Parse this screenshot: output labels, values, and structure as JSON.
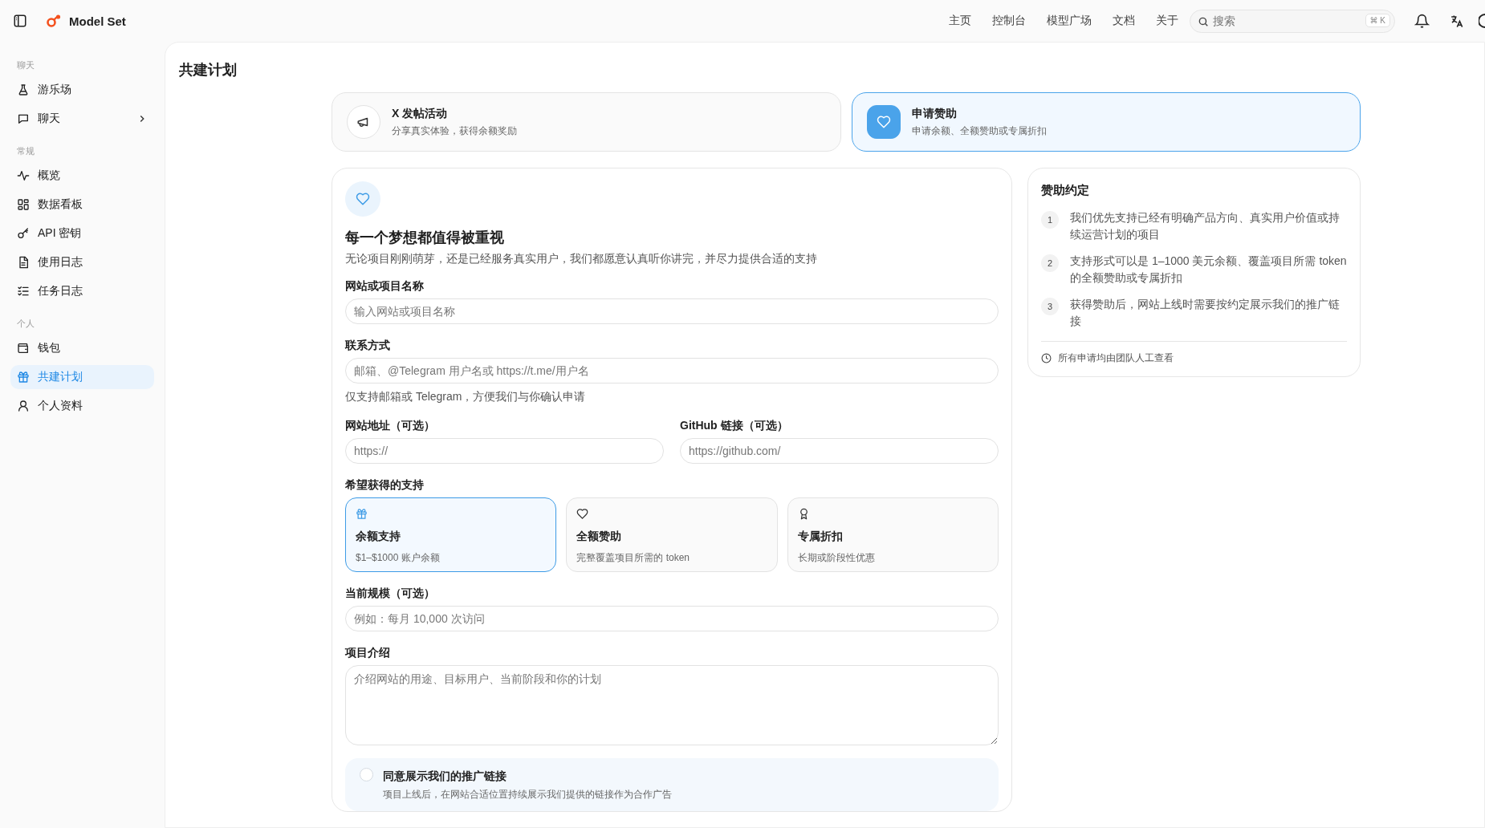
{
  "header": {
    "brand": "Model Set",
    "nav": [
      {
        "label": "主页"
      },
      {
        "label": "控制台"
      },
      {
        "label": "模型广场"
      },
      {
        "label": "文档"
      },
      {
        "label": "关于"
      }
    ],
    "search": {
      "placeholder": "搜索",
      "shortcut": "⌘ K"
    }
  },
  "sidebar": {
    "sections": [
      {
        "title": "聊天",
        "items": [
          {
            "label": "游乐场",
            "kind": "flask",
            "selected": false
          },
          {
            "label": "聊天",
            "kind": "chat",
            "selected": false,
            "expandable": true
          }
        ]
      },
      {
        "title": "常规",
        "items": [
          {
            "label": "概览",
            "kind": "pulse",
            "selected": false
          },
          {
            "label": "数据看板",
            "kind": "grid",
            "selected": false
          },
          {
            "label": "API 密钥",
            "kind": "key",
            "selected": false
          },
          {
            "label": "使用日志",
            "kind": "file",
            "selected": false
          },
          {
            "label": "任务日志",
            "kind": "list",
            "selected": false
          }
        ]
      },
      {
        "title": "个人",
        "items": [
          {
            "label": "钱包",
            "kind": "wallet",
            "selected": false
          },
          {
            "label": "共建计划",
            "kind": "gift",
            "selected": true
          },
          {
            "label": "个人资料",
            "kind": "user",
            "selected": false
          }
        ]
      }
    ]
  },
  "page": {
    "title": "共建计划"
  },
  "program_tabs": [
    {
      "title": "X 发帖活动",
      "subtitle": "分享真实体验，获得余额奖励",
      "kind": "megaphone",
      "selected": false
    },
    {
      "title": "申请赞助",
      "subtitle": "申请余额、全额赞助或专属折扣",
      "kind": "heart",
      "selected": true
    }
  ],
  "form": {
    "heading": "每一个梦想都值得被重视",
    "description": "无论项目刚刚萌芽，还是已经服务真实用户，我们都愿意认真听你讲完，并尽力提供合适的支持",
    "name_field": {
      "label": "网站或项目名称",
      "placeholder": "输入网站或项目名称"
    },
    "contact_field": {
      "label": "联系方式",
      "placeholder": "邮箱、@Telegram 用户名或 https://t.me/用户名",
      "hint": "仅支持邮箱或 Telegram，方便我们与你确认申请"
    },
    "website_field": {
      "label": "网站地址（可选）",
      "placeholder": "https://"
    },
    "github_field": {
      "label": "GitHub 链接（可选）",
      "placeholder": "https://github.com/"
    },
    "support": {
      "label": "希望获得的支持",
      "options": [
        {
          "title": "余额支持",
          "subtitle": "$1–$1000 账户余额",
          "kind": "gift",
          "selected": true
        },
        {
          "title": "全额赞助",
          "subtitle": "完整覆盖项目所需的 token",
          "kind": "heart",
          "selected": false
        },
        {
          "title": "专属折扣",
          "subtitle": "长期或阶段性优惠",
          "kind": "award",
          "selected": false
        }
      ]
    },
    "scale_field": {
      "label": "当前规模（可选）",
      "placeholder": "例如：每月 10,000 次访问"
    },
    "intro_field": {
      "label": "项目介绍",
      "placeholder": "介绍网站的用途、目标用户、当前阶段和你的计划"
    },
    "consent": {
      "title": "同意展示我们的推广链接",
      "description": "项目上线后，在网站合适位置持续展示我们提供的链接作为合作广告",
      "checked": false
    }
  },
  "terms": {
    "title": "赞助约定",
    "items": [
      {
        "number": "1",
        "text": "我们优先支持已经有明确产品方向、真实用户价值或持续运营计划的项目"
      },
      {
        "number": "2",
        "text": "支持形式可以是 1–1000 美元余额、覆盖项目所需 token 的全额赞助或专属折扣"
      },
      {
        "number": "3",
        "text": "获得赞助后，网站上线时需要按约定展示我们的推广链接"
      }
    ],
    "footnote": "所有申请均由团队人工查看"
  }
}
